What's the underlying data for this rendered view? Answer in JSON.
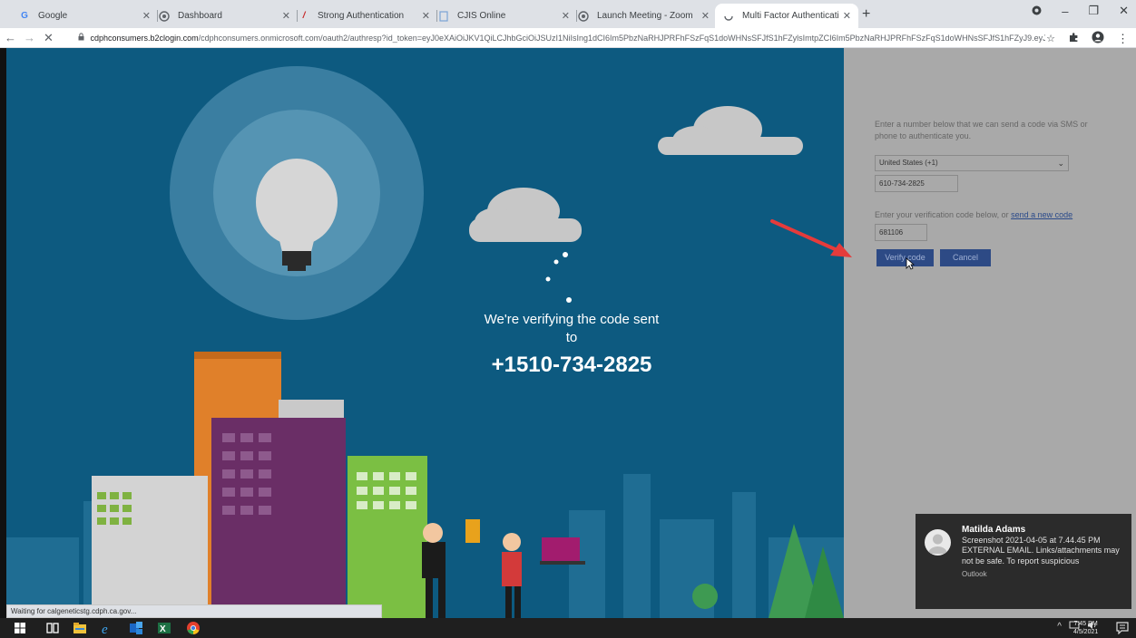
{
  "browser": {
    "tabs": [
      {
        "label": "Google",
        "icon": "google-icon",
        "active": false
      },
      {
        "label": "Dashboard",
        "icon": "globe-icon",
        "active": false
      },
      {
        "label": "Strong Authentication",
        "icon": "slash-icon",
        "active": false
      },
      {
        "label": "CJIS Online",
        "icon": "doc-icon",
        "active": false
      },
      {
        "label": "Launch Meeting - Zoom",
        "icon": "globe-icon",
        "active": false
      },
      {
        "label": "Multi Factor Authentication",
        "icon": "loading-icon",
        "active": true
      }
    ],
    "url_host": "cdphconsumers.b2clogin.com",
    "url_rest": "/cdphconsumers.onmicrosoft.com/oauth2/authresp?id_token=eyJ0eXAiOiJKV1QiLCJhbGciOiJSUzI1NiIsIng1dCI6Im5PbzNaRHJPRFhFSzFqS1doWHNsSFJfS1hFZylsImtpZCI6Im5PbzNaRHJPRFhFSzFqS1doWHNsSFJfS1hFZyJ9.eyJhdWQiOiJ..."
  },
  "verify": {
    "line1": "We're verifying the code sent",
    "line2": "to",
    "phone": "+1510-734-2825"
  },
  "form": {
    "intro": "Enter a number below that we can send a code via SMS or phone to authenticate you.",
    "country": "United States (+1)",
    "phone_value": "610-734-2825",
    "code_prompt": "Enter your verification code below, or ",
    "send_new_code": "send a new code",
    "code_value": "681106",
    "verify_label": "Verify code",
    "cancel_label": "Cancel"
  },
  "status": {
    "text": "Waiting for calgeneticstg.cdph.ca.gov..."
  },
  "toast": {
    "sender": "Matilda Adams",
    "subject": "Screenshot 2021-04-05 at 7.44.45 PM",
    "body": "EXTERNAL EMAIL. Links/attachments may not be safe. To report suspicious",
    "app": "Outlook"
  },
  "taskbar": {
    "time": "7:45 PM",
    "date": "4/5/2021"
  },
  "colors": {
    "scene_bg": "#0d5a80",
    "panel_bg": "#a9a9a9",
    "button_bg": "#2d4a85",
    "arrow": "#e53b3b"
  }
}
